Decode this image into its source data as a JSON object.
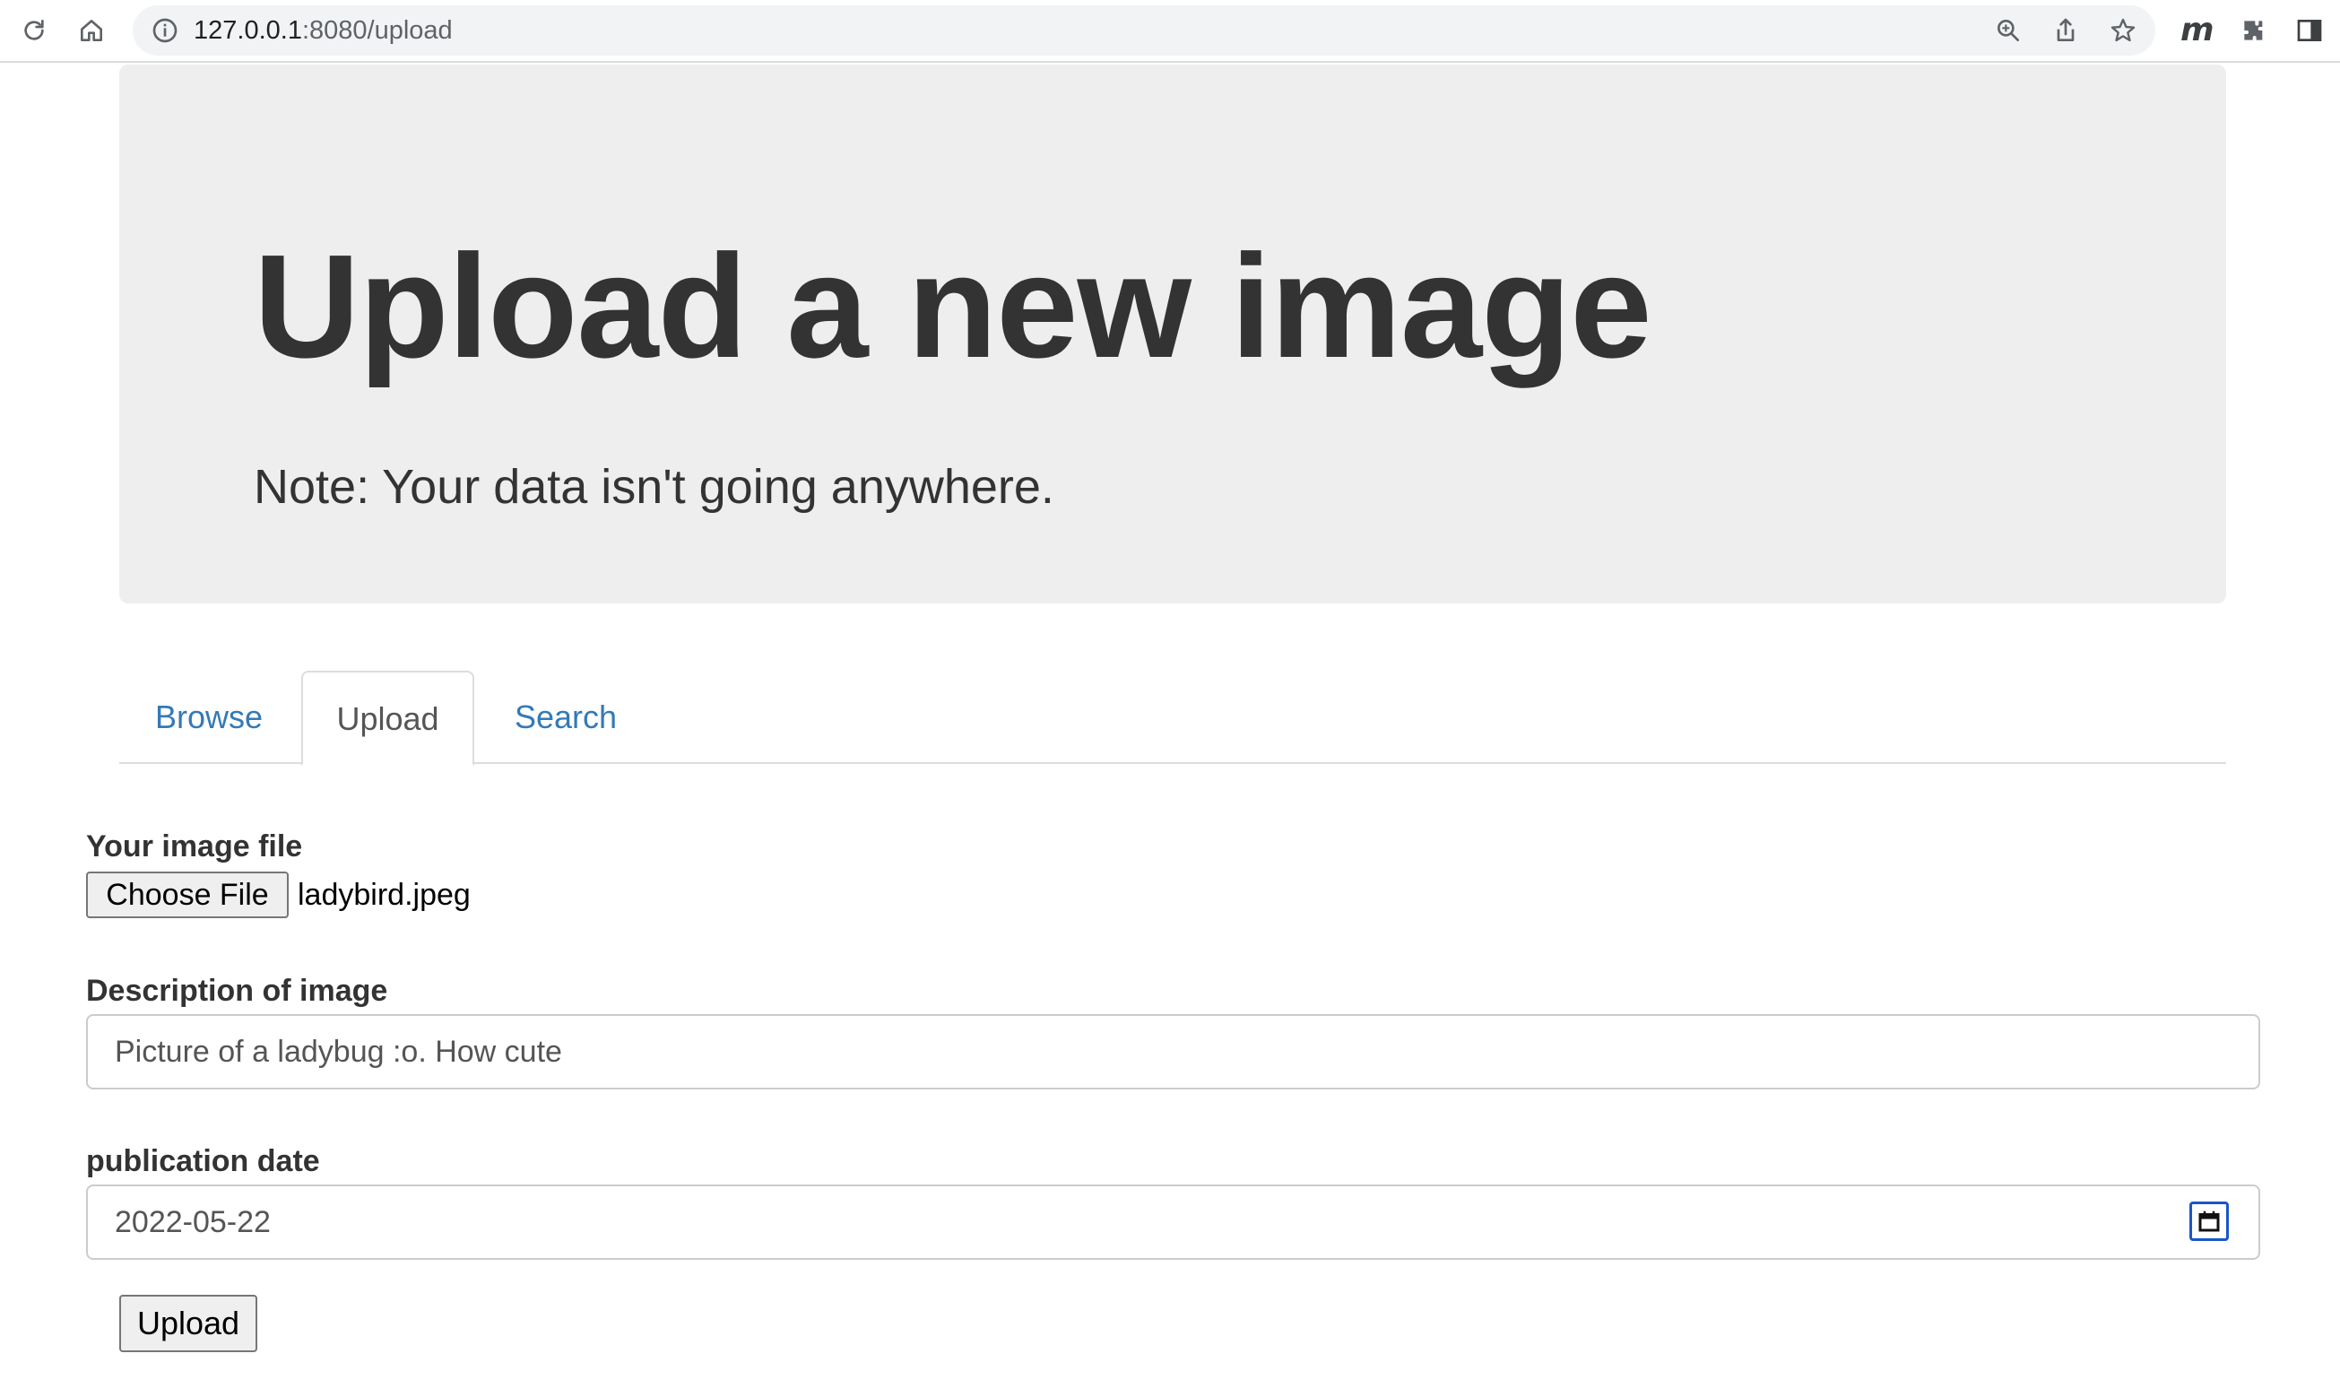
{
  "browser": {
    "url_host": "127.0.0.1",
    "url_rest": ":8080/upload",
    "extension_letter": "m"
  },
  "jumbotron": {
    "title": "Upload a new image",
    "note": "Note: Your data isn't going anywhere."
  },
  "tabs": [
    {
      "label": "Browse",
      "active": false
    },
    {
      "label": "Upload",
      "active": true
    },
    {
      "label": "Search",
      "active": false
    }
  ],
  "form": {
    "file": {
      "label": "Your image file",
      "button_label": "Choose File",
      "file_name": "ladybird.jpeg"
    },
    "description": {
      "label": "Description of image",
      "value": "Picture of a ladybug :o. How cute"
    },
    "date": {
      "label": "publication date",
      "value": "2022-05-22"
    },
    "submit_label": "Upload"
  },
  "colors": {
    "link": "#337ab7",
    "jumbotron_bg": "#eeeeee",
    "text": "#333333",
    "focus_ring": "#1a56c8"
  },
  "icons": [
    "reload-icon",
    "home-icon",
    "info-icon",
    "zoom-icon",
    "share-icon",
    "bookmark-star-icon",
    "extensions-icon",
    "side-panel-icon",
    "calendar-icon"
  ]
}
